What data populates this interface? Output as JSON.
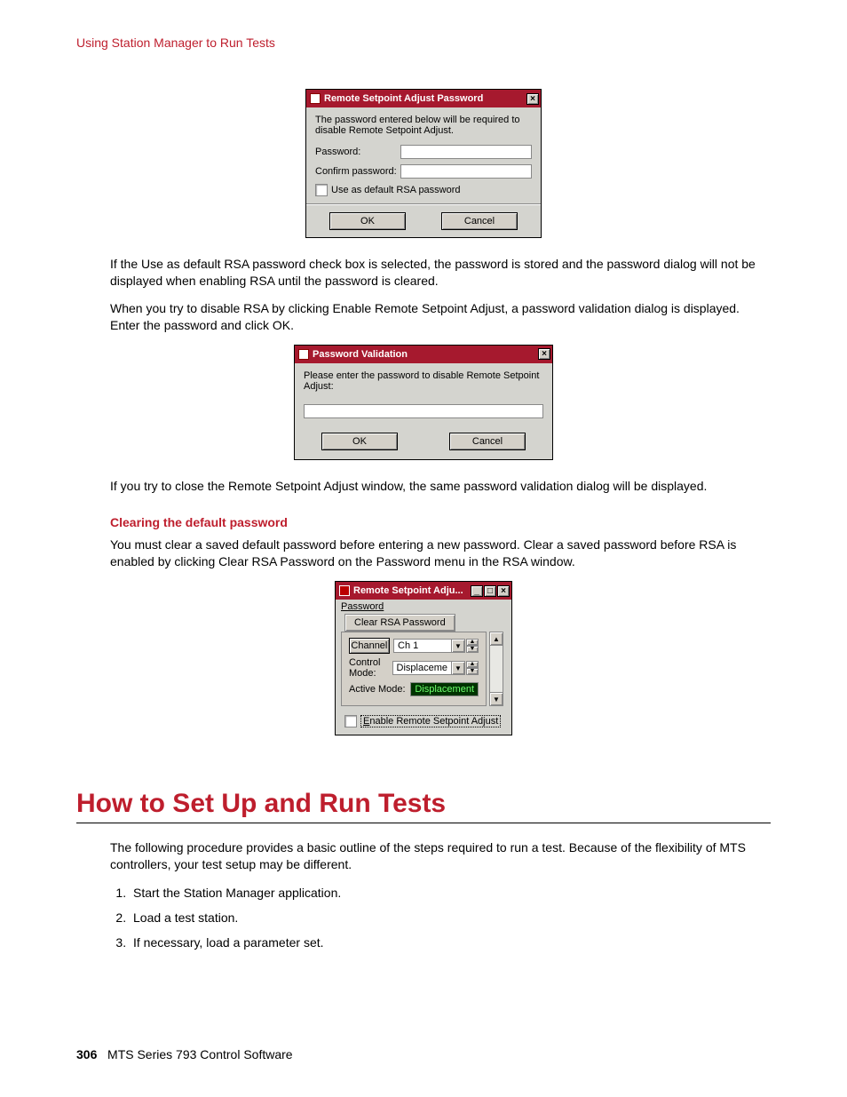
{
  "header": {
    "breadcrumb": "Using Station Manager to Run Tests"
  },
  "dialog1": {
    "title": "Remote Setpoint Adjust Password",
    "instruction": "The password entered below will be required to disable Remote Setpoint Adjust.",
    "password_label": "Password:",
    "confirm_label": "Confirm password:",
    "checkbox_label": "Use as default RSA password",
    "ok": "OK",
    "cancel": "Cancel"
  },
  "para1": "If the Use as default RSA password check box is selected, the password is stored and the password dialog will not be displayed when enabling RSA until the password is cleared.",
  "para2": "When you try to disable RSA by clicking Enable Remote Setpoint Adjust, a password validation dialog is displayed. Enter the password and click OK.",
  "dialog2": {
    "title": "Password Validation",
    "instruction": "Please enter the password to disable Remote Setpoint Adjust:",
    "ok": "OK",
    "cancel": "Cancel"
  },
  "para3": "If you try to close the Remote Setpoint Adjust window, the same password validation dialog will be displayed.",
  "subhead1": "Clearing the default password",
  "para4": "You must clear a saved default password before entering a new password. Clear a saved password before RSA is enabled by clicking Clear RSA Password on the Password menu in the RSA window.",
  "dialog3": {
    "title": "Remote Setpoint Adju...",
    "menu": "Password",
    "menu_item": "Clear RSA Password",
    "channel_btn": "Channel",
    "channel_value": "Ch 1",
    "control_mode_label": "Control Mode:",
    "control_mode_value": "Displaceme",
    "active_mode_label": "Active Mode:",
    "active_mode_value": "Displacement",
    "enable_checkbox": "Enable Remote Setpoint Adjust"
  },
  "section_title": "How to Set Up and Run Tests",
  "para5": "The following procedure provides a basic outline of the steps required to run a test. Because of the flexibility of MTS controllers, your test setup may be different.",
  "steps": [
    "Start the Station Manager application.",
    "Load a test station.",
    "If necessary, load a parameter set."
  ],
  "footer": {
    "page": "306",
    "doc": "MTS Series 793 Control Software"
  }
}
